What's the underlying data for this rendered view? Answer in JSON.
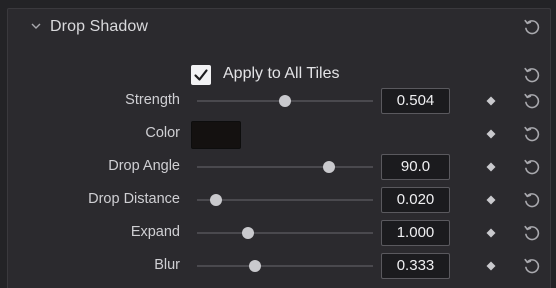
{
  "section": {
    "title": "Drop Shadow",
    "chevron_icon": "chevron-down-icon",
    "reset_icon": "reset-icon"
  },
  "apply_all": {
    "label": "Apply to All Tiles",
    "checked": true
  },
  "params": [
    {
      "id": "strength",
      "label": "Strength",
      "value": "0.504",
      "level": 0.5
    },
    {
      "id": "color",
      "label": "Color",
      "swatch": "#141110"
    },
    {
      "id": "drop-angle",
      "label": "Drop Angle",
      "value": "90.0",
      "level": 0.75
    },
    {
      "id": "drop-distance",
      "label": "Drop Distance",
      "value": "0.020",
      "level": 0.11
    },
    {
      "id": "expand",
      "label": "Expand",
      "value": "1.000",
      "level": 0.29
    },
    {
      "id": "blur",
      "label": "Blur",
      "value": "0.333",
      "level": 0.33
    }
  ],
  "colors": {
    "background": "#232326",
    "panel": "#2b2a2e",
    "text": "#cfcfd3",
    "value_text": "#f0f0f2",
    "track": "#4a494e",
    "thumb": "#c9c9cd",
    "keyframe": "#c9c9cd"
  }
}
